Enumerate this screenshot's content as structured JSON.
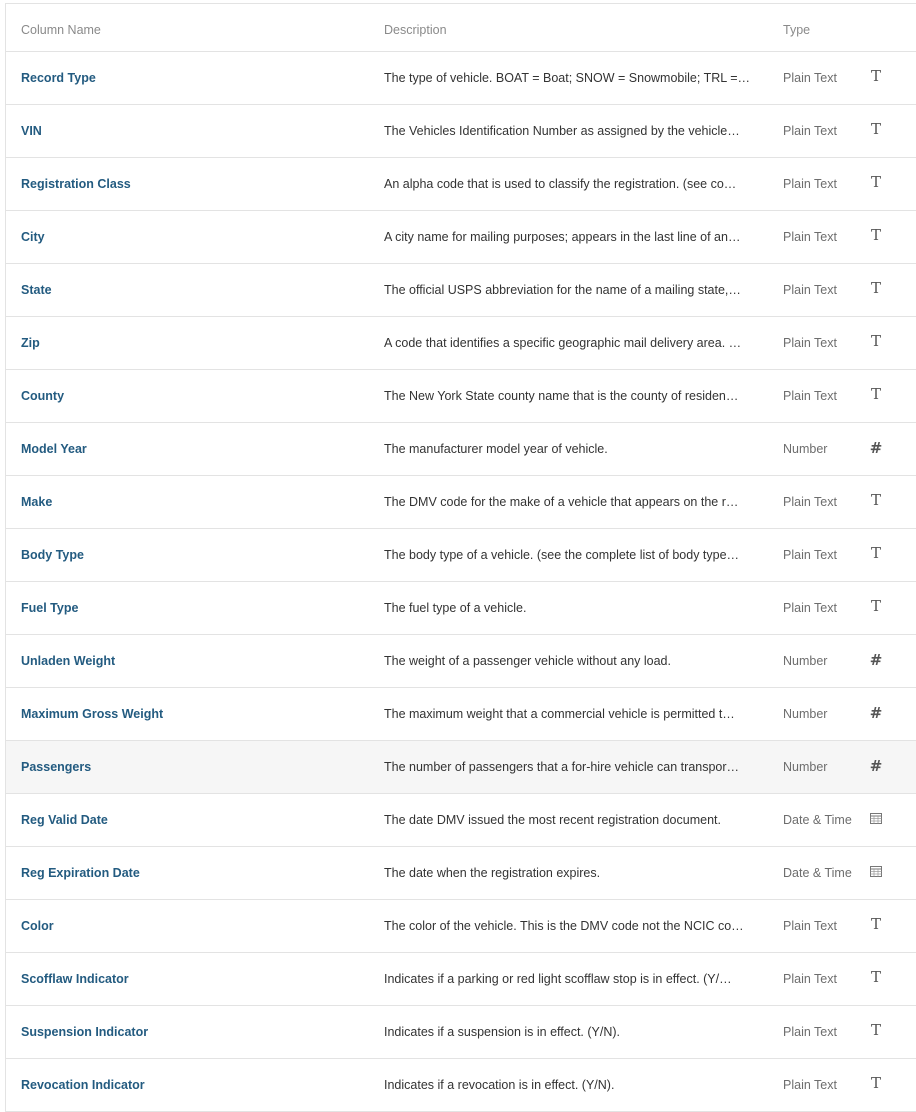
{
  "columns": {
    "name": "Column Name",
    "description": "Description",
    "type": "Type"
  },
  "rows": [
    {
      "name": "Record Type",
      "description": "The type of vehicle. BOAT = Boat; SNOW = Snowmobile; TRL = …",
      "type": "Plain Text",
      "icon": "text-type-icon"
    },
    {
      "name": "VIN",
      "description": "The Vehicles Identification Number as assigned by the vehicle…",
      "type": "Plain Text",
      "icon": "text-type-icon"
    },
    {
      "name": "Registration Class",
      "description": "An alpha code that is used to classify the registration. (see co…",
      "type": "Plain Text",
      "icon": "text-type-icon"
    },
    {
      "name": "City",
      "description": "A city name for mailing purposes; appears in the last line of an…",
      "type": "Plain Text",
      "icon": "text-type-icon"
    },
    {
      "name": "State",
      "description": "The official USPS abbreviation for the name of a mailing state,…",
      "type": "Plain Text",
      "icon": "text-type-icon"
    },
    {
      "name": "Zip",
      "description": "A code that identifies a specific geographic mail delivery area. …",
      "type": "Plain Text",
      "icon": "text-type-icon"
    },
    {
      "name": "County",
      "description": "The New York State county name that is the county of residen…",
      "type": "Plain Text",
      "icon": "text-type-icon"
    },
    {
      "name": "Model Year",
      "description": "The manufacturer model year of vehicle.",
      "type": "Number",
      "icon": "number-type-icon"
    },
    {
      "name": "Make",
      "description": "The DMV code for the make of a vehicle that appears on the r…",
      "type": "Plain Text",
      "icon": "text-type-icon"
    },
    {
      "name": "Body Type",
      "description": "The body type of a vehicle. (see the complete list of body type…",
      "type": "Plain Text",
      "icon": "text-type-icon"
    },
    {
      "name": "Fuel Type",
      "description": "The fuel type of a vehicle.",
      "type": "Plain Text",
      "icon": "text-type-icon"
    },
    {
      "name": "Unladen Weight",
      "description": "The weight of a passenger vehicle without any load.",
      "type": "Number",
      "icon": "number-type-icon"
    },
    {
      "name": "Maximum Gross Weight",
      "description": "The maximum weight that a commercial vehicle is permitted t…",
      "type": "Number",
      "icon": "number-type-icon"
    },
    {
      "name": "Passengers",
      "description": "The number of passengers that a for-hire vehicle can transpor…",
      "type": "Number",
      "icon": "number-type-icon",
      "highlighted": true
    },
    {
      "name": "Reg Valid Date",
      "description": "The date DMV issued the most recent registration document.",
      "type": "Date & Time",
      "icon": "calendar-type-icon"
    },
    {
      "name": "Reg Expiration Date",
      "description": "The date when the registration expires.",
      "type": "Date & Time",
      "icon": "calendar-type-icon"
    },
    {
      "name": "Color",
      "description": "The color of the vehicle. This is the DMV code not the NCIC co…",
      "type": "Plain Text",
      "icon": "text-type-icon"
    },
    {
      "name": "Scofflaw Indicator",
      "description": "Indicates if a parking or red light scofflaw stop is in effect. (Y/…",
      "type": "Plain Text",
      "icon": "text-type-icon"
    },
    {
      "name": "Suspension Indicator",
      "description": "Indicates if a suspension is in effect. (Y/N).",
      "type": "Plain Text",
      "icon": "text-type-icon"
    },
    {
      "name": "Revocation Indicator",
      "description": "Indicates if a revocation is in effect. (Y/N).",
      "type": "Plain Text",
      "icon": "text-type-icon"
    }
  ],
  "colors": {
    "name_link": "#235b80",
    "header_text": "#8a8a8a",
    "border": "#e3e3e3",
    "highlight_row": "#f6f6f6"
  }
}
